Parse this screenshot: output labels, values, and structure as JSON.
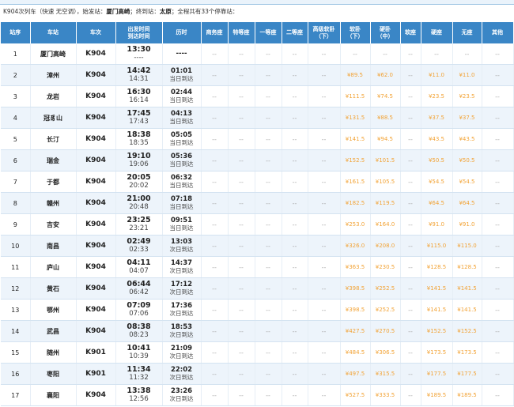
{
  "summary": {
    "prefix": "K904次列车（快速 无空调），始发站：",
    "origin": "厦门高崎",
    "mid": "；终到站：",
    "terminus": "太原",
    "suffix": "；全程共有33个停靠站："
  },
  "columns": [
    "站序",
    "车站",
    "车次",
    "出发时间\n到达时间",
    "历时",
    "商务座",
    "特等座",
    "一等座",
    "二等座",
    "高级软卧\n（下）",
    "软卧\n（下）",
    "硬卧\n（中）",
    "软座",
    "硬座",
    "无座",
    "其他"
  ],
  "rows": [
    {
      "idx": "1",
      "station": "厦门高崎",
      "train": "K904",
      "dep": "13:30",
      "arr": "----",
      "dur": "----",
      "day": "",
      "rw": "--",
      "yw": "--",
      "yz": "--",
      "wz": "--"
    },
    {
      "idx": "2",
      "station": "漳州",
      "train": "K904",
      "dep": "14:42",
      "arr": "14:31",
      "dur": "01:01",
      "day": "当日到达",
      "rw": "¥89.5",
      "yw": "¥62.0",
      "yz": "¥11.0",
      "wz": "¥11.0"
    },
    {
      "idx": "3",
      "station": "龙岩",
      "train": "K904",
      "dep": "16:30",
      "arr": "16:14",
      "dur": "02:44",
      "day": "当日到达",
      "rw": "¥111.5",
      "yw": "¥74.5",
      "yz": "¥23.5",
      "wz": "¥23.5"
    },
    {
      "idx": "4",
      "station": "冠豸山",
      "train": "K904",
      "dep": "17:45",
      "arr": "17:43",
      "dur": "04:13",
      "day": "当日到达",
      "rw": "¥131.5",
      "yw": "¥88.5",
      "yz": "¥37.5",
      "wz": "¥37.5"
    },
    {
      "idx": "5",
      "station": "长汀",
      "train": "K904",
      "dep": "18:38",
      "arr": "18:35",
      "dur": "05:05",
      "day": "当日到达",
      "rw": "¥141.5",
      "yw": "¥94.5",
      "yz": "¥43.5",
      "wz": "¥43.5"
    },
    {
      "idx": "6",
      "station": "瑞金",
      "train": "K904",
      "dep": "19:10",
      "arr": "19:06",
      "dur": "05:36",
      "day": "当日到达",
      "rw": "¥152.5",
      "yw": "¥101.5",
      "yz": "¥50.5",
      "wz": "¥50.5"
    },
    {
      "idx": "7",
      "station": "于都",
      "train": "K904",
      "dep": "20:05",
      "arr": "20:02",
      "dur": "06:32",
      "day": "当日到达",
      "rw": "¥161.5",
      "yw": "¥105.5",
      "yz": "¥54.5",
      "wz": "¥54.5"
    },
    {
      "idx": "8",
      "station": "赣州",
      "train": "K904",
      "dep": "21:00",
      "arr": "20:48",
      "dur": "07:18",
      "day": "当日到达",
      "rw": "¥182.5",
      "yw": "¥119.5",
      "yz": "¥64.5",
      "wz": "¥64.5"
    },
    {
      "idx": "9",
      "station": "吉安",
      "train": "K904",
      "dep": "23:25",
      "arr": "23:21",
      "dur": "09:51",
      "day": "当日到达",
      "rw": "¥253.0",
      "yw": "¥164.0",
      "yz": "¥91.0",
      "wz": "¥91.0"
    },
    {
      "idx": "10",
      "station": "南昌",
      "train": "K904",
      "dep": "02:49",
      "arr": "02:33",
      "dur": "13:03",
      "day": "次日到达",
      "rw": "¥326.0",
      "yw": "¥208.0",
      "yz": "¥115.0",
      "wz": "¥115.0"
    },
    {
      "idx": "11",
      "station": "庐山",
      "train": "K904",
      "dep": "04:11",
      "arr": "04:07",
      "dur": "14:37",
      "day": "次日到达",
      "rw": "¥363.5",
      "yw": "¥230.5",
      "yz": "¥128.5",
      "wz": "¥128.5"
    },
    {
      "idx": "12",
      "station": "黄石",
      "train": "K904",
      "dep": "06:44",
      "arr": "06:42",
      "dur": "17:12",
      "day": "次日到达",
      "rw": "¥398.5",
      "yw": "¥252.5",
      "yz": "¥141.5",
      "wz": "¥141.5"
    },
    {
      "idx": "13",
      "station": "鄂州",
      "train": "K904",
      "dep": "07:09",
      "arr": "07:06",
      "dur": "17:36",
      "day": "次日到达",
      "rw": "¥398.5",
      "yw": "¥252.5",
      "yz": "¥141.5",
      "wz": "¥141.5"
    },
    {
      "idx": "14",
      "station": "武昌",
      "train": "K904",
      "dep": "08:38",
      "arr": "08:23",
      "dur": "18:53",
      "day": "次日到达",
      "rw": "¥427.5",
      "yw": "¥270.5",
      "yz": "¥152.5",
      "wz": "¥152.5"
    },
    {
      "idx": "15",
      "station": "随州",
      "train": "K901",
      "dep": "10:41",
      "arr": "10:39",
      "dur": "21:09",
      "day": "次日到达",
      "rw": "¥484.5",
      "yw": "¥306.5",
      "yz": "¥173.5",
      "wz": "¥173.5"
    },
    {
      "idx": "16",
      "station": "枣阳",
      "train": "K901",
      "dep": "11:34",
      "arr": "11:32",
      "dur": "22:02",
      "day": "次日到达",
      "rw": "¥497.5",
      "yw": "¥315.5",
      "yz": "¥177.5",
      "wz": "¥177.5"
    },
    {
      "idx": "17",
      "station": "襄阳",
      "train": "K904",
      "dep": "13:38",
      "arr": "12:56",
      "dur": "23:26",
      "day": "次日到达",
      "rw": "¥527.5",
      "yw": "¥333.5",
      "yz": "¥189.5",
      "wz": "¥189.5"
    }
  ],
  "empty_cell": "--"
}
